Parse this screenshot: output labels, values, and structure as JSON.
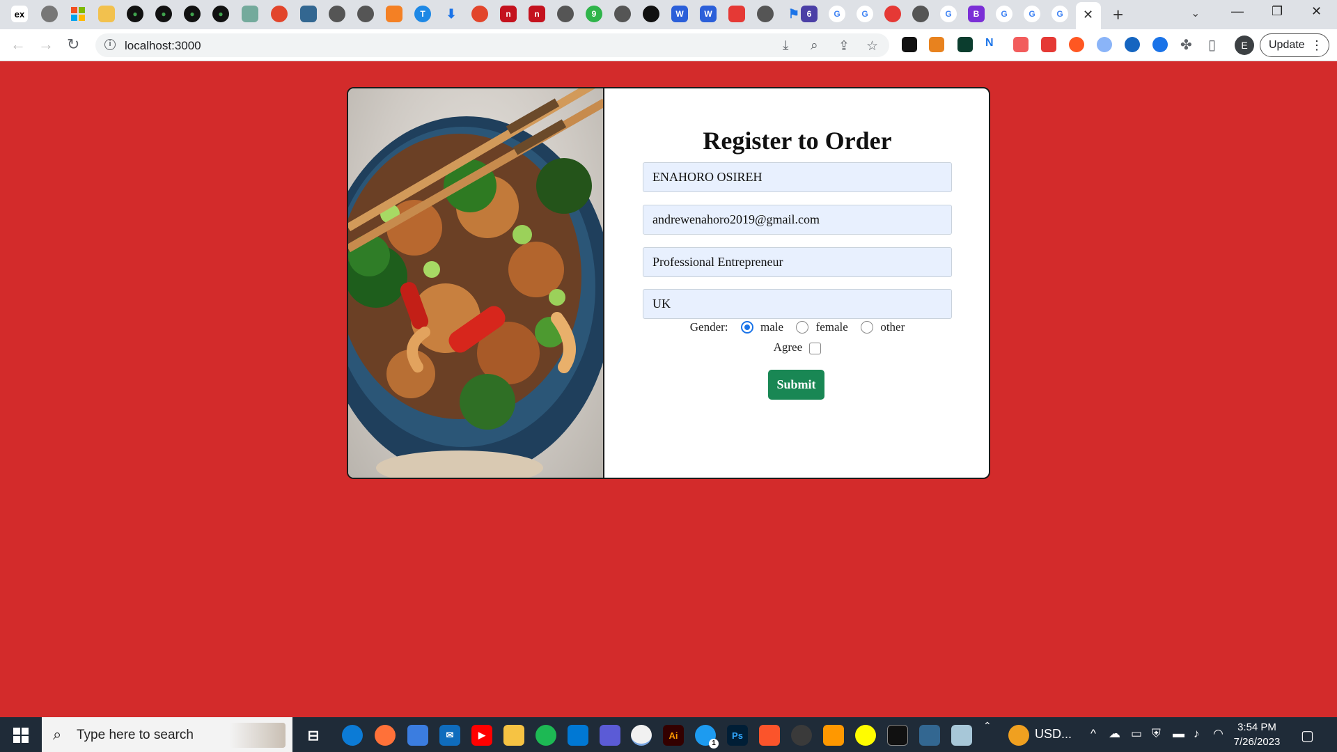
{
  "browser": {
    "address_url": "localhost:3000",
    "profile_initial": "E",
    "update_label": "Update",
    "tab_close_glyph": "✕",
    "new_tab_glyph": "+"
  },
  "page": {
    "background_color": "#d32b2b",
    "form": {
      "title": "Register to Order",
      "fields": [
        {
          "name": "full-name",
          "value": "ENAHORO OSIREH"
        },
        {
          "name": "email",
          "value": "andrewenahoro2019@gmail.com"
        },
        {
          "name": "occupation",
          "value": "Professional Entrepreneur"
        },
        {
          "name": "country",
          "value": "UK"
        }
      ],
      "gender_label": "Gender:",
      "gender_options": [
        "male",
        "female",
        "other"
      ],
      "gender_selected": "male",
      "agree_label": "Agree",
      "agree_checked": false,
      "submit_label": "Submit",
      "submit_color": "#198754"
    },
    "image_alt": "food-bowl-photo"
  },
  "taskbar": {
    "search_placeholder": "Type here to search",
    "weather_text": "USD...",
    "time": "3:54 PM",
    "date": "7/26/2023",
    "twitter_badge": "1"
  }
}
